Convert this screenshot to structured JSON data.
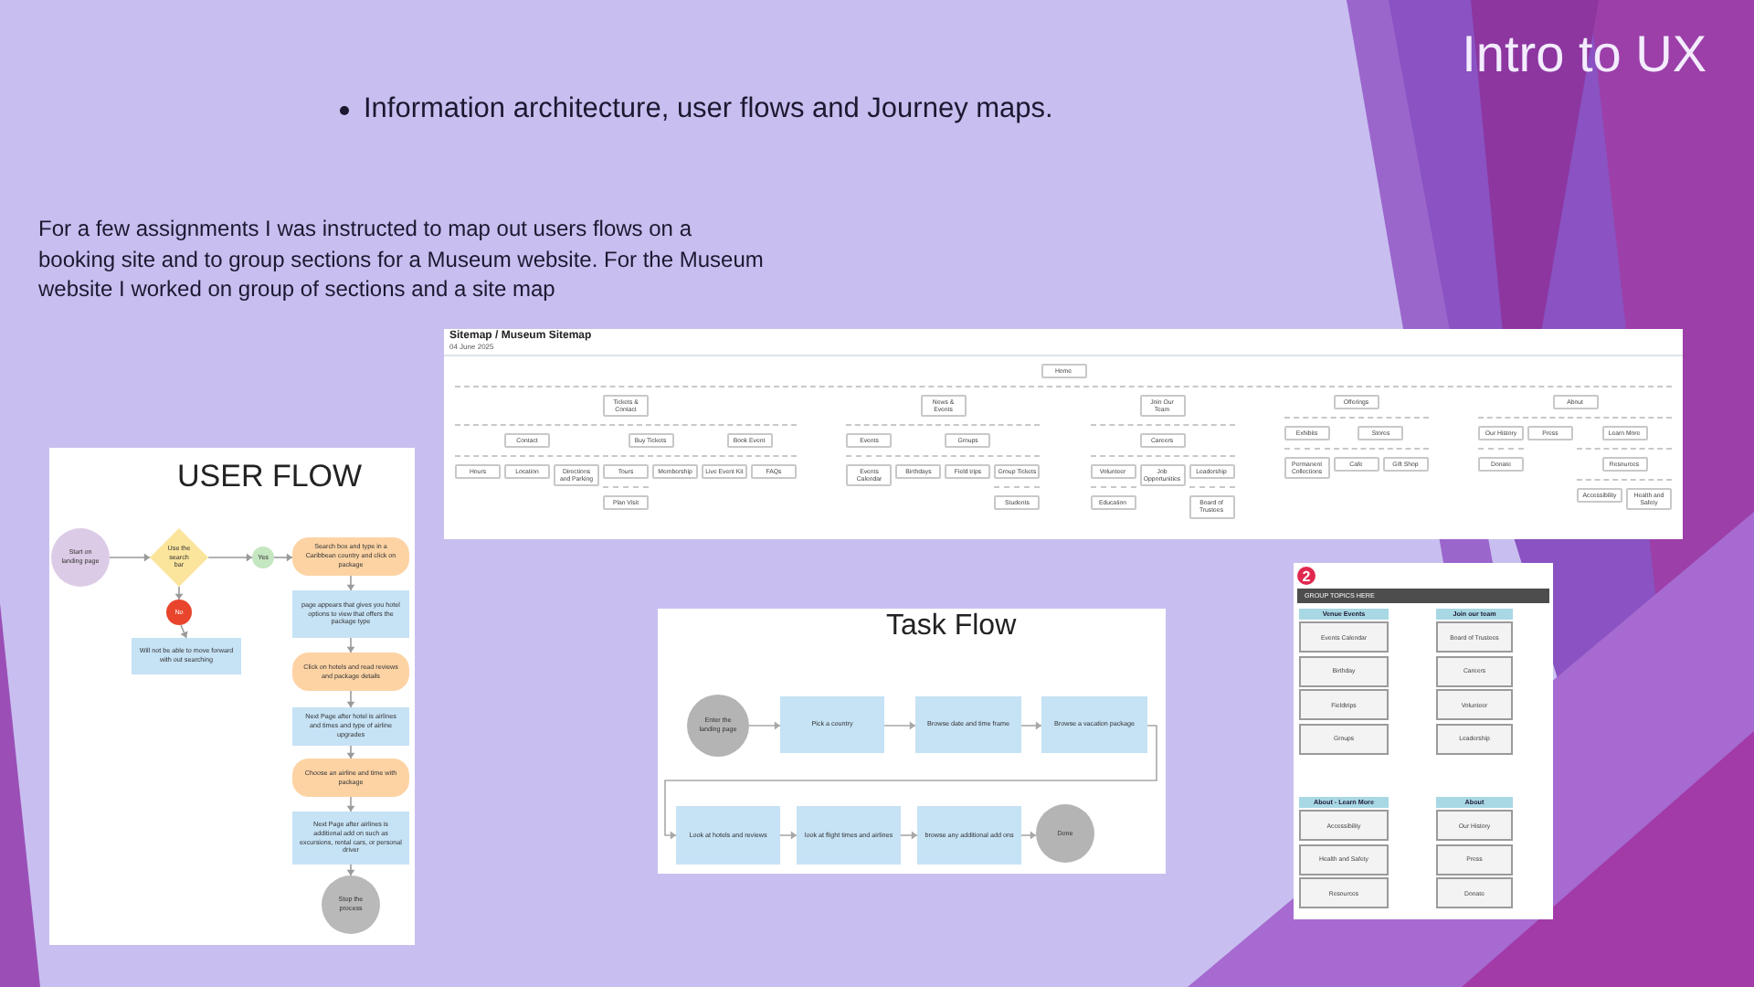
{
  "slide_title": "Intro to UX",
  "bullets": [
    "Information architecture, user flows and Journey maps."
  ],
  "paragraph": "For a few assignments I was instructed to map out users flows on a booking site and to group sections for a Museum website. For the Museum website I worked on group of sections and a site map",
  "sitemap": {
    "title": "Sitemap / Museum Sitemap",
    "date": "04 June 2025",
    "root": {
      "label": "Home",
      "children": [
        {
          "label": "Tickets & Contact",
          "children": [
            {
              "label": "Contact",
              "children": [
                {
                  "label": "Hours"
                },
                {
                  "label": "Location"
                },
                {
                  "label": "Directions and Parking"
                }
              ]
            },
            {
              "label": "Buy Tickets",
              "children": [
                {
                  "label": "Tours",
                  "children": [
                    {
                      "label": "Plan Visit"
                    }
                  ]
                },
                {
                  "label": "Membership"
                }
              ]
            },
            {
              "label": "Book Event",
              "children": [
                {
                  "label": "Live Event Kit"
                },
                {
                  "label": "FAQs"
                }
              ]
            }
          ]
        },
        {
          "label": "News & Events",
          "children": [
            {
              "label": "Events",
              "children": [
                {
                  "label": "Events Calendar"
                }
              ]
            },
            {
              "label": "Groups",
              "children": [
                {
                  "label": "Birthdays"
                },
                {
                  "label": "Field trips"
                },
                {
                  "label": "Group Tickets",
                  "children": [
                    {
                      "label": "Students"
                    }
                  ]
                }
              ]
            }
          ]
        },
        {
          "label": "Join Our Team",
          "children": [
            {
              "label": "Careers",
              "children": [
                {
                  "label": "Volunteer",
                  "children": [
                    {
                      "label": "Education"
                    }
                  ]
                },
                {
                  "label": "Job Opportunities"
                },
                {
                  "label": "Leadership",
                  "children": [
                    {
                      "label": "Board of Trustees"
                    }
                  ]
                }
              ]
            }
          ]
        },
        {
          "label": "Offerings",
          "children": [
            {
              "label": "Exhibits",
              "children": [
                {
                  "label": "Permanent Collections"
                }
              ]
            },
            {
              "label": "Stores",
              "children": [
                {
                  "label": "Cafe"
                },
                {
                  "label": "Gift Shop"
                }
              ]
            }
          ]
        },
        {
          "label": "About",
          "children": [
            {
              "label": "Our History",
              "children": [
                {
                  "label": "Donate"
                }
              ]
            },
            {
              "label": "Press"
            },
            {
              "label": "Learn More",
              "children": [
                {
                  "label": "Resources",
                  "children": [
                    {
                      "label": "Accessibility"
                    },
                    {
                      "label": "Health and Safety"
                    }
                  ]
                }
              ]
            }
          ]
        }
      ]
    }
  },
  "user_flow": {
    "title": "USER FLOW",
    "nodes": [
      {
        "kind": "start",
        "text": "Start on landing page"
      },
      {
        "kind": "decision",
        "text": "Use the search bar"
      },
      {
        "kind": "yes",
        "text": "Yes"
      },
      {
        "kind": "no",
        "text": "No"
      },
      {
        "kind": "screen",
        "text": "Will not be able to move forward with out searching"
      },
      {
        "kind": "action",
        "text": "Search box and type in a Caribbean country and click on package"
      },
      {
        "kind": "screen",
        "text": "page appears that gives you hotel options to view that offers the package type"
      },
      {
        "kind": "action",
        "text": "Click on hotels and read reviews and package details"
      },
      {
        "kind": "screen",
        "text": "Next Page after hotel is airlines and times and type of airline upgrades"
      },
      {
        "kind": "action",
        "text": "Choose an airline and time with package"
      },
      {
        "kind": "screen",
        "text": "Next Page after airlines is additional add on such as excursions, rental cars, or personal driver"
      },
      {
        "kind": "end",
        "text": "Stop the process"
      }
    ]
  },
  "task_flow": {
    "title": "Task Flow",
    "nodes": [
      {
        "kind": "circle",
        "text": "Enter the landing page"
      },
      {
        "kind": "box",
        "text": "Pick a country"
      },
      {
        "kind": "box",
        "text": "Browse date and time frame"
      },
      {
        "kind": "box",
        "text": "Browse a vacation package"
      },
      {
        "kind": "box",
        "text": "Look at hotels and reviews"
      },
      {
        "kind": "box",
        "text": "look at flight times and airlines"
      },
      {
        "kind": "box",
        "text": "browse any additional add ons"
      },
      {
        "kind": "circle",
        "text": "Done"
      }
    ]
  },
  "card_sort": {
    "badge": "2",
    "banner": "GROUP TOPICS HERE",
    "groups": [
      {
        "title": "Venue Events",
        "cards": [
          "Events Calendar",
          "Birthday",
          "Fieldtrips",
          "Groups"
        ]
      },
      {
        "title": "Join our team",
        "cards": [
          "Board of Trustees",
          "Careers",
          "Volunteer",
          "Leadership"
        ]
      },
      {
        "title": "About - Learn More",
        "cards": [
          "Accessibility",
          "Health and Safety",
          "Resources"
        ]
      },
      {
        "title": "About",
        "cards": [
          "Our History",
          "Press",
          "Donate"
        ]
      }
    ]
  }
}
